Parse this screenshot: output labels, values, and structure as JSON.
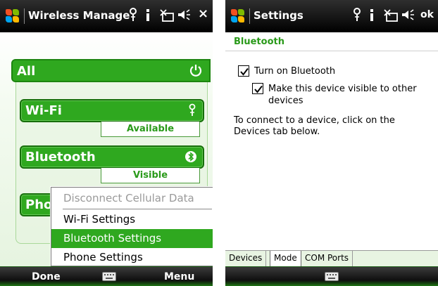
{
  "left": {
    "title": "Wireless Manage",
    "header_icons": [
      "antenna-icon",
      "signal-icon",
      "connectivity-icon",
      "volume-icon"
    ],
    "close_label": "×",
    "all_label": "All",
    "radios": [
      {
        "label": "Wi-Fi",
        "icon": "antenna-icon",
        "status": "Available"
      },
      {
        "label": "Bluetooth",
        "icon": "bluetooth-icon",
        "status": "Visible"
      },
      {
        "label": "Pho"
      }
    ],
    "menu": {
      "items": [
        {
          "label": "Disconnect Cellular Data",
          "state": "disabled"
        },
        {
          "label": "Wi-Fi Settings",
          "state": "normal"
        },
        {
          "label": "Bluetooth Settings",
          "state": "selected"
        },
        {
          "label": "Phone Settings",
          "state": "normal"
        }
      ]
    },
    "softkeys": {
      "left": "Done",
      "right": "Menu"
    }
  },
  "right": {
    "title": "Settings",
    "ok_label": "ok",
    "section": "Bluetooth",
    "checkboxes": [
      {
        "label": "Turn on Bluetooth",
        "checked": true
      },
      {
        "label": "Make this device visible to other devices",
        "checked": true
      }
    ],
    "info": "To connect to a device, click on the Devices tab below.",
    "tabs": [
      "Devices",
      "Mode",
      "COM Ports"
    ],
    "active_tab": "Mode"
  },
  "colors": {
    "accent": "#2fa81f",
    "accent_dark": "#176f0b",
    "title_bg": "#1a1a1a"
  }
}
